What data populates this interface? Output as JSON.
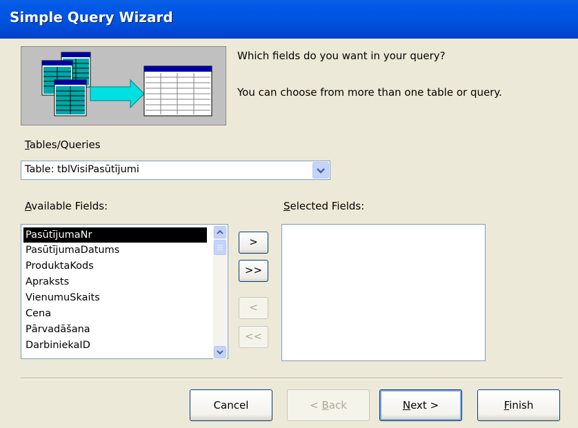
{
  "window": {
    "title": "Simple Query Wizard"
  },
  "intro": {
    "line1": "Which fields do you want in your query?",
    "line2": "You can choose from more than one table or query."
  },
  "tables_queries": {
    "label_key": "T",
    "label_rest": "ables/Queries",
    "selected": "Table: tblVisiPasūtījumi"
  },
  "available": {
    "label_key": "A",
    "label_rest": "vailable Fields:",
    "items": [
      "PasūtījumaNr",
      "PasūtījumaDatums",
      "ProduktaKods",
      "Apraksts",
      "VienumuSkaits",
      "Cena",
      "Pārvadāšana",
      "DarbiniekaID"
    ],
    "selected_index": 0
  },
  "selected_fields": {
    "label_key": "S",
    "label_rest": "elected Fields:",
    "items": []
  },
  "move_buttons": {
    "add_one": ">",
    "add_all": ">>",
    "remove_one": "<",
    "remove_all": "<<"
  },
  "footer": {
    "cancel": "Cancel",
    "back_pre": "< ",
    "back_key": "B",
    "back_rest": "ack",
    "next_key": "N",
    "next_rest": "ext >",
    "finish_key": "F",
    "finish_rest": "inish"
  },
  "colors": {
    "titlebar": "#0054E3",
    "dialog_bg": "#ECE9D8",
    "selection_bg": "#000000",
    "accent_teal": "#00B0B0"
  }
}
